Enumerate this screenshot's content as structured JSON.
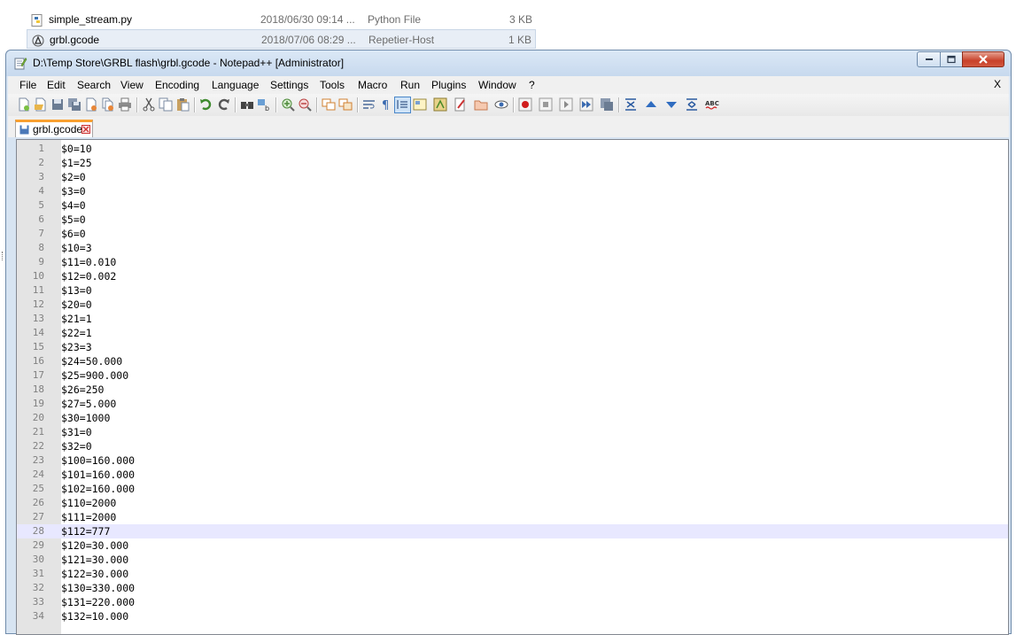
{
  "explorer": {
    "files": [
      {
        "name": "simple_stream.py",
        "date": "2018/06/30 09:14 ...",
        "type": "Python File",
        "size": "3 KB",
        "icon": "python-file-icon",
        "selected": false
      },
      {
        "name": "grbl.gcode",
        "date": "2018/07/06 08:29 ...",
        "type": "Repetier-Host",
        "size": "1 KB",
        "icon": "repetier-file-icon",
        "selected": true
      }
    ]
  },
  "window": {
    "title": "D:\\Temp Store\\GRBL flash\\grbl.gcode - Notepad++ [Administrator]",
    "controls": {
      "minimize": "minimize",
      "maximize": "maximize",
      "close": "close"
    }
  },
  "menu": {
    "items": [
      "File",
      "Edit",
      "Search",
      "View",
      "Encoding",
      "Language",
      "Settings",
      "Tools",
      "Macro",
      "Run",
      "Plugins",
      "Window",
      "?"
    ],
    "close_doc": "X"
  },
  "toolbar": {
    "buttons": [
      "new-file-icon",
      "open-file-icon",
      "save-icon",
      "save-all-icon",
      "close-icon",
      "close-all-icon",
      "print-icon",
      "cut-icon",
      "copy-icon",
      "paste-icon",
      "undo-icon",
      "redo-icon",
      "find-icon",
      "replace-icon",
      "zoom-in-icon",
      "zoom-out-icon",
      "sync-vertical-icon",
      "sync-horizontal-icon",
      "word-wrap-icon",
      "show-all-chars-icon",
      "indent-guide-icon",
      "document-map-icon",
      "function-list-icon",
      "folder-as-workspace-icon",
      "doc-switcher-icon",
      "monitoring-icon",
      "record-macro-icon",
      "stop-record-icon",
      "play-macro-icon",
      "run-macro-multiple-icon",
      "save-macro-icon",
      "fold-all-icon",
      "move-up-icon",
      "move-down-icon",
      "unfold-all-icon",
      "spell-check-icon"
    ]
  },
  "tabs": [
    {
      "label": "grbl.gcode",
      "active": true
    }
  ],
  "editor": {
    "current_line": 28,
    "lines": [
      {
        "n": "1",
        "text": "$0=10"
      },
      {
        "n": "2",
        "text": "$1=25"
      },
      {
        "n": "3",
        "text": "$2=0"
      },
      {
        "n": "4",
        "text": "$3=0"
      },
      {
        "n": "5",
        "text": "$4=0"
      },
      {
        "n": "6",
        "text": "$5=0"
      },
      {
        "n": "7",
        "text": "$6=0"
      },
      {
        "n": "8",
        "text": "$10=3"
      },
      {
        "n": "9",
        "text": "$11=0.010"
      },
      {
        "n": "10",
        "text": "$12=0.002"
      },
      {
        "n": "11",
        "text": "$13=0"
      },
      {
        "n": "12",
        "text": "$20=0"
      },
      {
        "n": "13",
        "text": "$21=1"
      },
      {
        "n": "14",
        "text": "$22=1"
      },
      {
        "n": "15",
        "text": "$23=3"
      },
      {
        "n": "16",
        "text": "$24=50.000"
      },
      {
        "n": "17",
        "text": "$25=900.000"
      },
      {
        "n": "18",
        "text": "$26=250"
      },
      {
        "n": "19",
        "text": "$27=5.000"
      },
      {
        "n": "20",
        "text": "$30=1000"
      },
      {
        "n": "21",
        "text": "$31=0"
      },
      {
        "n": "22",
        "text": "$32=0"
      },
      {
        "n": "23",
        "text": "$100=160.000"
      },
      {
        "n": "24",
        "text": "$101=160.000"
      },
      {
        "n": "25",
        "text": "$102=160.000"
      },
      {
        "n": "26",
        "text": "$110=2000"
      },
      {
        "n": "27",
        "text": "$111=2000"
      },
      {
        "n": "28",
        "text": "$112=777"
      },
      {
        "n": "29",
        "text": "$120=30.000"
      },
      {
        "n": "30",
        "text": "$121=30.000"
      },
      {
        "n": "31",
        "text": "$122=30.000"
      },
      {
        "n": "32",
        "text": "$130=330.000"
      },
      {
        "n": "33",
        "text": "$131=220.000"
      },
      {
        "n": "34",
        "text": "$132=10.000"
      }
    ]
  }
}
